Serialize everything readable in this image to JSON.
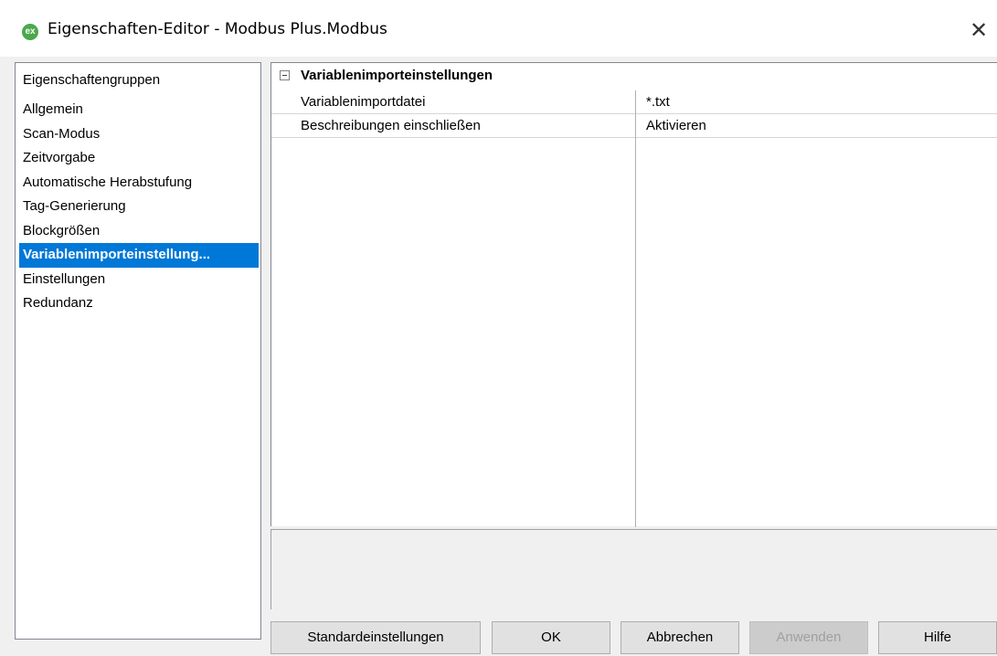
{
  "window": {
    "title": "Eigenschaften-Editor - Modbus Plus.Modbus",
    "app_icon_label": "ex",
    "close_symbol": "✕",
    "app_icon_color": "#4aa84a"
  },
  "groups": {
    "header": "Eigenschaftengruppen",
    "items": [
      {
        "label": "Allgemein"
      },
      {
        "label": "Scan-Modus"
      },
      {
        "label": "Zeitvorgabe"
      },
      {
        "label": "Automatische Herabstufung"
      },
      {
        "label": "Tag-Generierung"
      },
      {
        "label": "Blockgrößen"
      },
      {
        "label": "Variablenimporteinstellung..."
      },
      {
        "label": "Einstellungen"
      },
      {
        "label": "Redundanz"
      }
    ],
    "selected_index": 6,
    "selection_color": "#0078d7"
  },
  "properties": {
    "category": "Variablenimporteinstellungen",
    "rows": [
      {
        "name": "Variablenimportdatei",
        "value": "*.txt"
      },
      {
        "name": "Beschreibungen einschließen",
        "value": "Aktivieren"
      }
    ]
  },
  "buttons": {
    "defaults": "Standardeinstellungen",
    "ok": "OK",
    "cancel": "Abbrechen",
    "apply": "Anwenden",
    "help": "Hilfe"
  }
}
